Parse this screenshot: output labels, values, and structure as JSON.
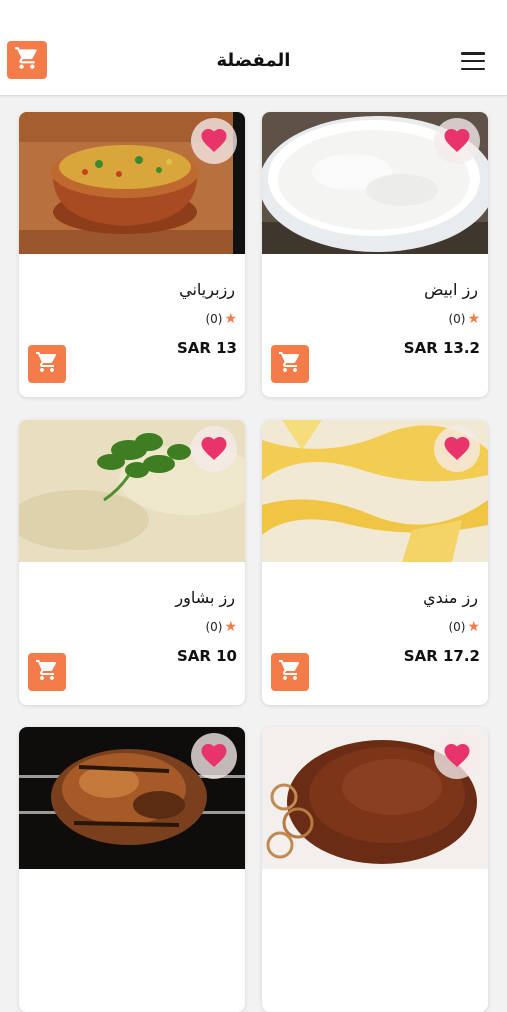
{
  "header": {
    "title": "المفضلة",
    "cart_icon": "cart-icon",
    "menu_icon": "hamburger-menu-icon"
  },
  "colors": {
    "accent": "#f47b4a",
    "favorite": "#e8336b",
    "background": "#f2f2f2"
  },
  "items": [
    {
      "name": "رز ابيض",
      "rating_count": "(0)",
      "price": "SAR 13.2",
      "image": "white-rice"
    },
    {
      "name": "رزبرياني",
      "rating_count": "(0)",
      "price": "SAR 13",
      "image": "biryani-rice"
    },
    {
      "name": "رز مندي",
      "rating_count": "(0)",
      "price": "SAR 17.2",
      "image": "mandi-rice"
    },
    {
      "name": "رز بشاور",
      "rating_count": "(0)",
      "price": "SAR 10",
      "image": "bashawar-rice"
    },
    {
      "name": "",
      "rating_count": "",
      "price": "",
      "image": "brown-rice"
    },
    {
      "name": "",
      "rating_count": "",
      "price": "",
      "image": "grilled-chicken"
    }
  ]
}
